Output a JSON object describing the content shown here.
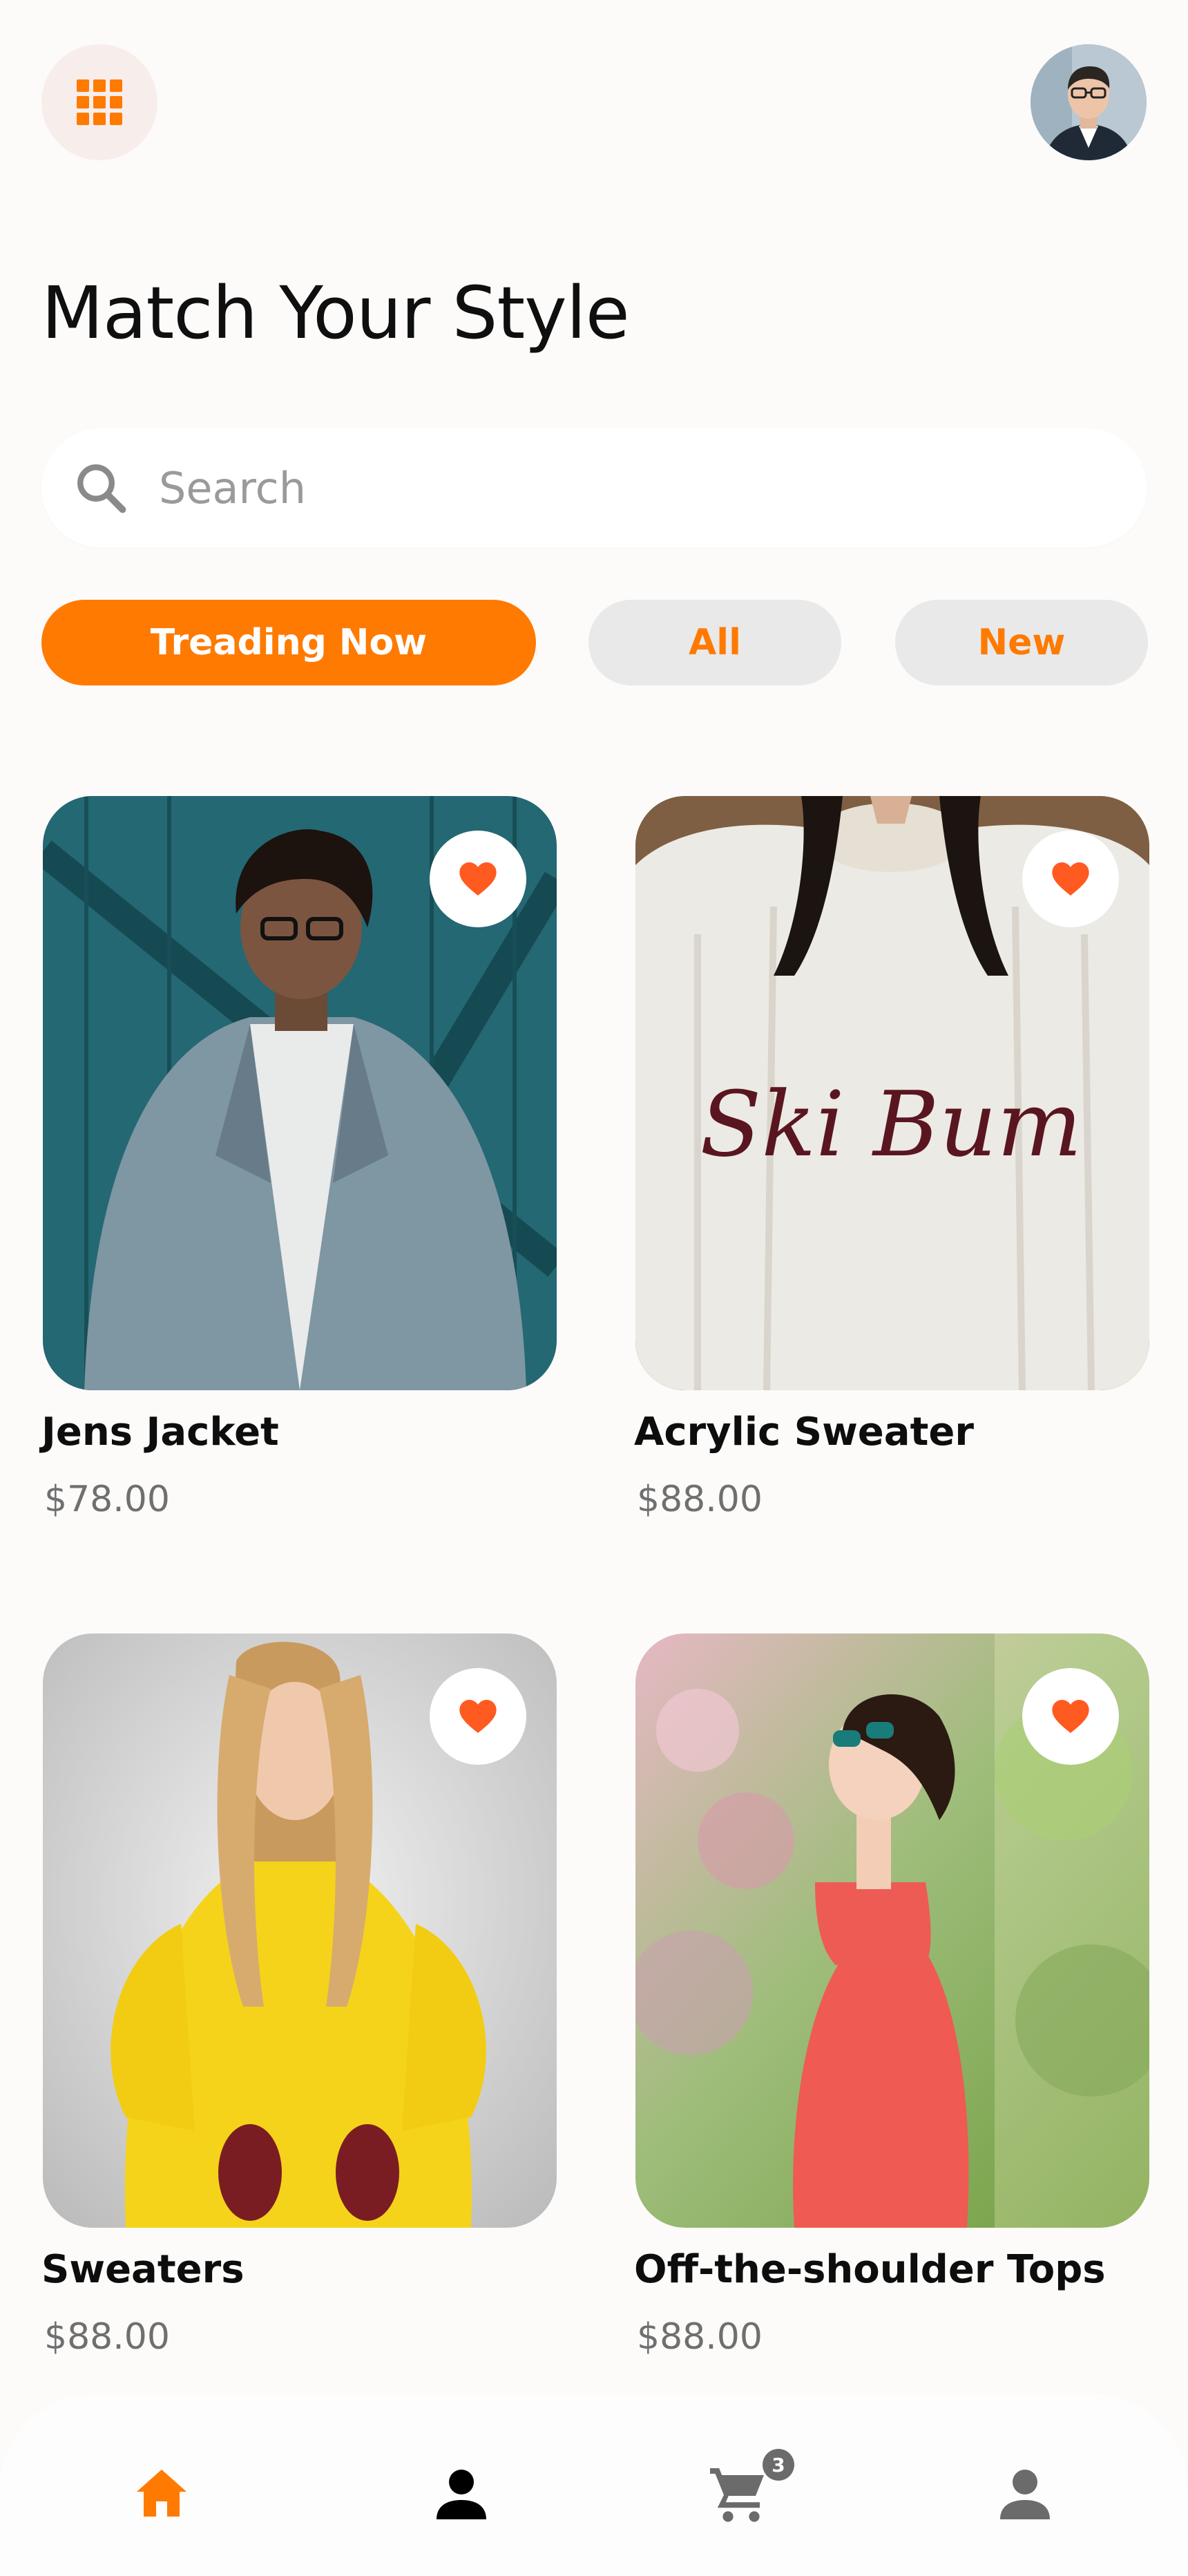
{
  "header": {
    "menu_icon": "grid-icon",
    "avatar_icon": "user-avatar"
  },
  "page_title": "Match Your Style",
  "search": {
    "placeholder": "Search",
    "value": ""
  },
  "filters": [
    {
      "label": "Treading Now",
      "active": true
    },
    {
      "label": "All",
      "active": false
    },
    {
      "label": "New",
      "active": false
    }
  ],
  "products": [
    {
      "name": "Jens Jacket",
      "price": "$78.00",
      "favorite": true
    },
    {
      "name": "Acrylic Sweater",
      "price": "$88.00",
      "favorite": true
    },
    {
      "name": "Sweaters",
      "price": "$88.00",
      "favorite": true
    },
    {
      "name": "Off-the-shoulder Tops",
      "price": "$88.00",
      "favorite": true
    }
  ],
  "bottom_nav": {
    "items": [
      {
        "icon": "home-icon",
        "active": true
      },
      {
        "icon": "person-icon",
        "active": false
      },
      {
        "icon": "cart-icon",
        "active": false
      },
      {
        "icon": "profile-icon",
        "active": false
      }
    ],
    "cart_badge": "3"
  },
  "colors": {
    "accent": "#ff7a00",
    "heart": "#ff5a1f",
    "background": "#fcfbfa",
    "chip_inactive_bg": "#e9e9e9",
    "price_text": "#6f6f6f"
  }
}
